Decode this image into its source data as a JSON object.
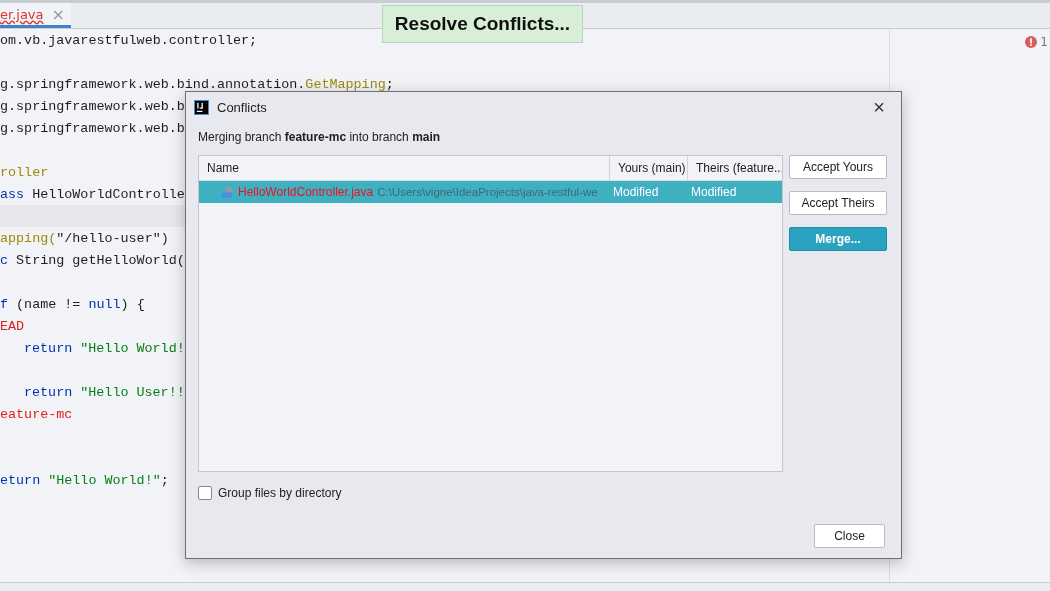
{
  "editor": {
    "tab": {
      "label": "er.java",
      "close": "×"
    },
    "blocks": [
      {
        "current_line_before": false,
        "extra_gap_before": false,
        "lines": [
          {
            "indent": false,
            "segments": [
              {
                "kind": "plain",
                "text": "om.vb.javarestfulweb.controller;"
              }
            ]
          }
        ]
      },
      {
        "current_line_before": false,
        "extra_gap_before": false,
        "lines": [
          {
            "indent": false,
            "segments": [
              {
                "kind": "plain",
                "text": "g.springframework.web.bind.annotation."
              },
              {
                "kind": "annotation",
                "text": "GetMapping"
              },
              {
                "kind": "plain",
                "text": ";"
              }
            ]
          },
          {
            "indent": false,
            "segments": [
              {
                "kind": "plain",
                "text": "g.springframework.web.b"
              }
            ]
          },
          {
            "indent": false,
            "segments": [
              {
                "kind": "plain",
                "text": "g.springframework.web.b"
              }
            ]
          }
        ]
      },
      {
        "current_line_before": false,
        "extra_gap_before": false,
        "lines": [
          {
            "indent": false,
            "segments": [
              {
                "kind": "annotation",
                "text": "roller"
              }
            ]
          },
          {
            "indent": false,
            "segments": [
              {
                "kind": "keyword",
                "text": "ass"
              },
              {
                "kind": "plain",
                "text": " HelloWorldControlle"
              }
            ]
          }
        ]
      },
      {
        "current_line_before": true,
        "extra_gap_before": false,
        "lines": [
          {
            "indent": false,
            "segments": [
              {
                "kind": "annotation",
                "text": "apping("
              },
              {
                "kind": "plain",
                "text": "\"/hello-user\")"
              }
            ]
          },
          {
            "indent": false,
            "segments": [
              {
                "kind": "keyword",
                "text": "c"
              },
              {
                "kind": "plain",
                "text": " String getHelloWorld("
              }
            ]
          }
        ]
      },
      {
        "current_line_before": false,
        "extra_gap_before": false,
        "lines": [
          {
            "indent": false,
            "segments": [
              {
                "kind": "keyword",
                "text": "f"
              },
              {
                "kind": "plain",
                "text": " (name != "
              },
              {
                "kind": "keyword",
                "text": "null"
              },
              {
                "kind": "plain",
                "text": ") {"
              }
            ]
          },
          {
            "indent": false,
            "segments": [
              {
                "kind": "conflict",
                "text": "EAD"
              }
            ]
          },
          {
            "indent": true,
            "segments": [
              {
                "kind": "keyword",
                "text": "return"
              },
              {
                "kind": "string",
                "text": " \"Hello World!"
              }
            ]
          }
        ]
      },
      {
        "current_line_before": false,
        "extra_gap_before": false,
        "lines": [
          {
            "indent": true,
            "segments": [
              {
                "kind": "keyword",
                "text": "return"
              },
              {
                "kind": "string",
                "text": " \"Hello User!!"
              }
            ]
          },
          {
            "indent": false,
            "segments": [
              {
                "kind": "conflict",
                "text": "eature-mc"
              }
            ]
          }
        ]
      },
      {
        "current_line_before": false,
        "extra_gap_before": true,
        "lines": [
          {
            "indent": false,
            "segments": [
              {
                "kind": "keyword",
                "text": "eturn"
              },
              {
                "kind": "string",
                "text": " \"Hello World!\""
              },
              {
                "kind": "plain",
                "text": ";"
              }
            ]
          }
        ]
      }
    ],
    "problems": "1"
  },
  "tooltip": "Resolve Conflicts...",
  "dialog": {
    "title": "Conflicts",
    "close": "×",
    "message": "Merging branch **feature-mc** into branch **main**",
    "columns": [
      "Name",
      "Yours (main)",
      "Theirs (feature..."
    ],
    "rows": [
      {
        "name": "HelloWorldController.java",
        "path": "C:\\Users\\vigne\\IdeaProjects\\java-restful-we",
        "yours": "Modified",
        "theirs": "Modified",
        "selected": true
      }
    ],
    "buttons": [
      {
        "label": "Accept Yours",
        "kind": "normal"
      },
      {
        "label": "Accept Theirs",
        "kind": "normal"
      },
      {
        "label": "Merge...",
        "kind": "primary"
      }
    ],
    "group_by_directory": {
      "label": "Group files by directory",
      "checked": false
    },
    "close_button": "Close"
  }
}
